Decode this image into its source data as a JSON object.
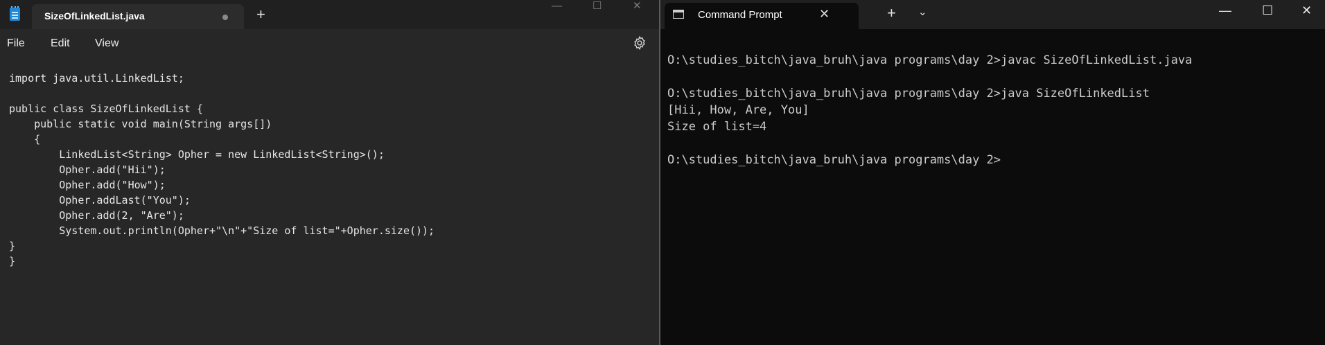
{
  "notepad": {
    "tab_title": "SizeOfLinkedList.java",
    "new_tab": "+",
    "window_controls": {
      "minimize": "—",
      "maximize": "☐",
      "close": "✕"
    },
    "menu": {
      "file": "File",
      "edit": "Edit",
      "view": "View"
    },
    "settings_icon": "gear-icon",
    "code_lines": [
      "import java.util.LinkedList;",
      "",
      "public class SizeOfLinkedList {",
      "    public static void main(String args[])",
      "    {",
      "        LinkedList<String> Opher = new LinkedList<String>();",
      "        Opher.add(\"Hii\");",
      "        Opher.add(\"How\");",
      "        Opher.addLast(\"You\");",
      "        Opher.add(2, \"Are\");",
      "        System.out.println(Opher+\"\\n\"+\"Size of list=\"+Opher.size());",
      "}",
      "}"
    ]
  },
  "terminal": {
    "tab_title": "Command Prompt",
    "tab_close": "✕",
    "new_tab": "+",
    "dropdown": "⌄",
    "window_controls": {
      "minimize": "—",
      "maximize": "☐",
      "close": "✕"
    },
    "lines": [
      "O:\\studies_bitch\\java_bruh\\java programs\\day 2>javac SizeOfLinkedList.java",
      "",
      "O:\\studies_bitch\\java_bruh\\java programs\\day 2>java SizeOfLinkedList",
      "[Hii, How, Are, You]",
      "Size of list=4",
      "",
      "O:\\studies_bitch\\java_bruh\\java programs\\day 2>"
    ]
  },
  "colors": {
    "notepad_bg": "#272727",
    "titlebar_bg": "#202020",
    "terminal_bg": "#0c0c0c",
    "terminal_text": "#cccccc",
    "notepad_icon": "#1e88d9"
  }
}
